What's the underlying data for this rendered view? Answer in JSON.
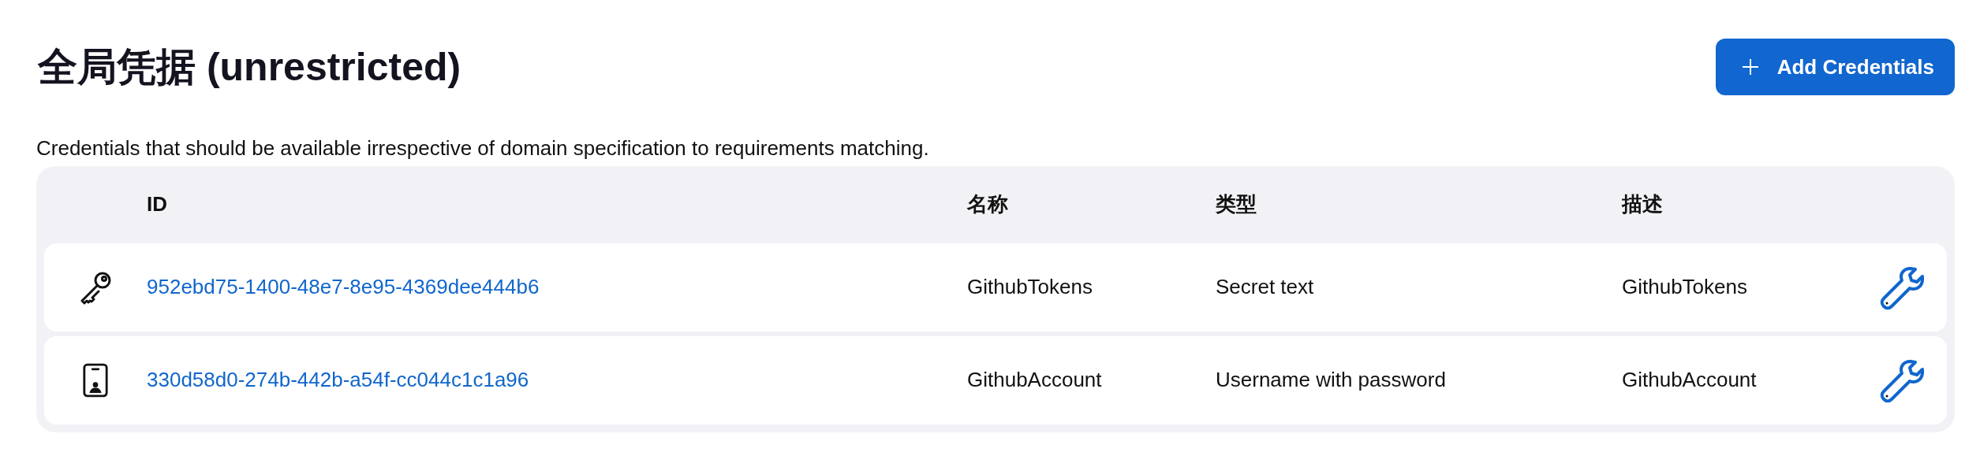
{
  "title": "全局凭据 (unrestricted)",
  "add_button": {
    "label": "Add Credentials"
  },
  "description": "Credentials that should be available irrespective of domain specification to requirements matching.",
  "table": {
    "columns": [
      "ID",
      "名称",
      "类型",
      "描述"
    ],
    "rows": [
      {
        "kind": "key",
        "id": "952ebd75-1400-48e7-8e95-4369dee444b6",
        "name": "GithubTokens",
        "type": "Secret text",
        "description": "GithubTokens"
      },
      {
        "kind": "badge",
        "id": "330d58d0-274b-442b-a54f-cc044c1c1a96",
        "name": "GithubAccount",
        "type": "Username with password",
        "description": "GithubAccount"
      }
    ]
  }
}
